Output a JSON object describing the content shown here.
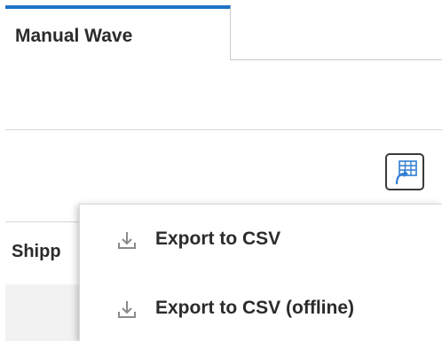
{
  "tabs": {
    "active_label": "Manual Wave"
  },
  "toolbar": {
    "export_button_icon": "grid-export-icon"
  },
  "table": {
    "header_cell": "Shipp"
  },
  "export_menu": {
    "items": [
      {
        "label": "Export to CSV",
        "icon": "download-icon"
      },
      {
        "label": "Export to CSV (offline)",
        "icon": "download-icon"
      }
    ]
  },
  "colors": {
    "tab_accent": "#1f73c7",
    "text": "#2b2b2b",
    "icon_gray": "#8a8a8a",
    "grid_icon_blue": "#2f7fd1"
  }
}
